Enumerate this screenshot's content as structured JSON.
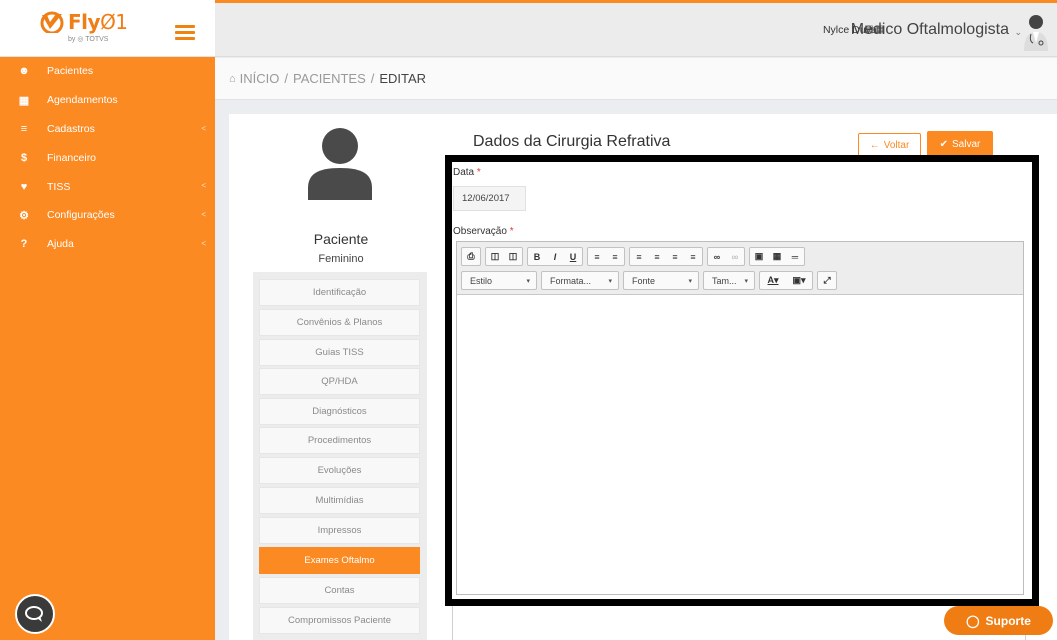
{
  "app": {
    "logo_text": "Fly",
    "logo_zero": "Ø1",
    "logo_sub": "by ◎ TOTVS",
    "accent": "#fb8a23"
  },
  "sidebar": {
    "items": [
      {
        "label": "Pacientes",
        "icon": "users-icon",
        "has_chevron": false
      },
      {
        "label": "Agendamentos",
        "icon": "calendar-icon",
        "has_chevron": false
      },
      {
        "label": "Cadastros",
        "icon": "list-icon",
        "has_chevron": true
      },
      {
        "label": "Financeiro",
        "icon": "dollar-icon",
        "has_chevron": false
      },
      {
        "label": "TISS",
        "icon": "heart-icon",
        "has_chevron": true
      },
      {
        "label": "Configurações",
        "icon": "gear-icon",
        "has_chevron": true
      },
      {
        "label": "Ajuda",
        "icon": "question-icon",
        "has_chevron": true
      }
    ]
  },
  "topbar": {
    "user_name": "Nylce Duval",
    "role": "Medico Oftalmologista"
  },
  "breadcrumb": {
    "home": "INÍCIO",
    "section": "PACIENTES",
    "current": "EDITAR"
  },
  "patient": {
    "title": "Paciente",
    "sex": "Feminino"
  },
  "patient_menu": {
    "items": [
      "Identificação",
      "Convênios & Planos",
      "Guias TISS",
      "QP/HDA",
      "Diagnósticos",
      "Procedimentos",
      "Evoluções",
      "Multimídias",
      "Impressos",
      "Exames Oftalmo",
      "Contas",
      "Compromissos Paciente"
    ],
    "active": "Exames Oftalmo"
  },
  "form": {
    "title": "Dados da Cirurgia Refrativa",
    "back_label": "Voltar",
    "save_label": "Salvar",
    "date_label": "Data",
    "date_value": "12/06/2017",
    "obs_label": "Observação",
    "required_mark": "*"
  },
  "editor": {
    "style_combo": "Estilo",
    "format_combo": "Formata...",
    "font_combo": "Fonte",
    "size_combo": "Tam..."
  },
  "support": {
    "label": "Suporte"
  }
}
